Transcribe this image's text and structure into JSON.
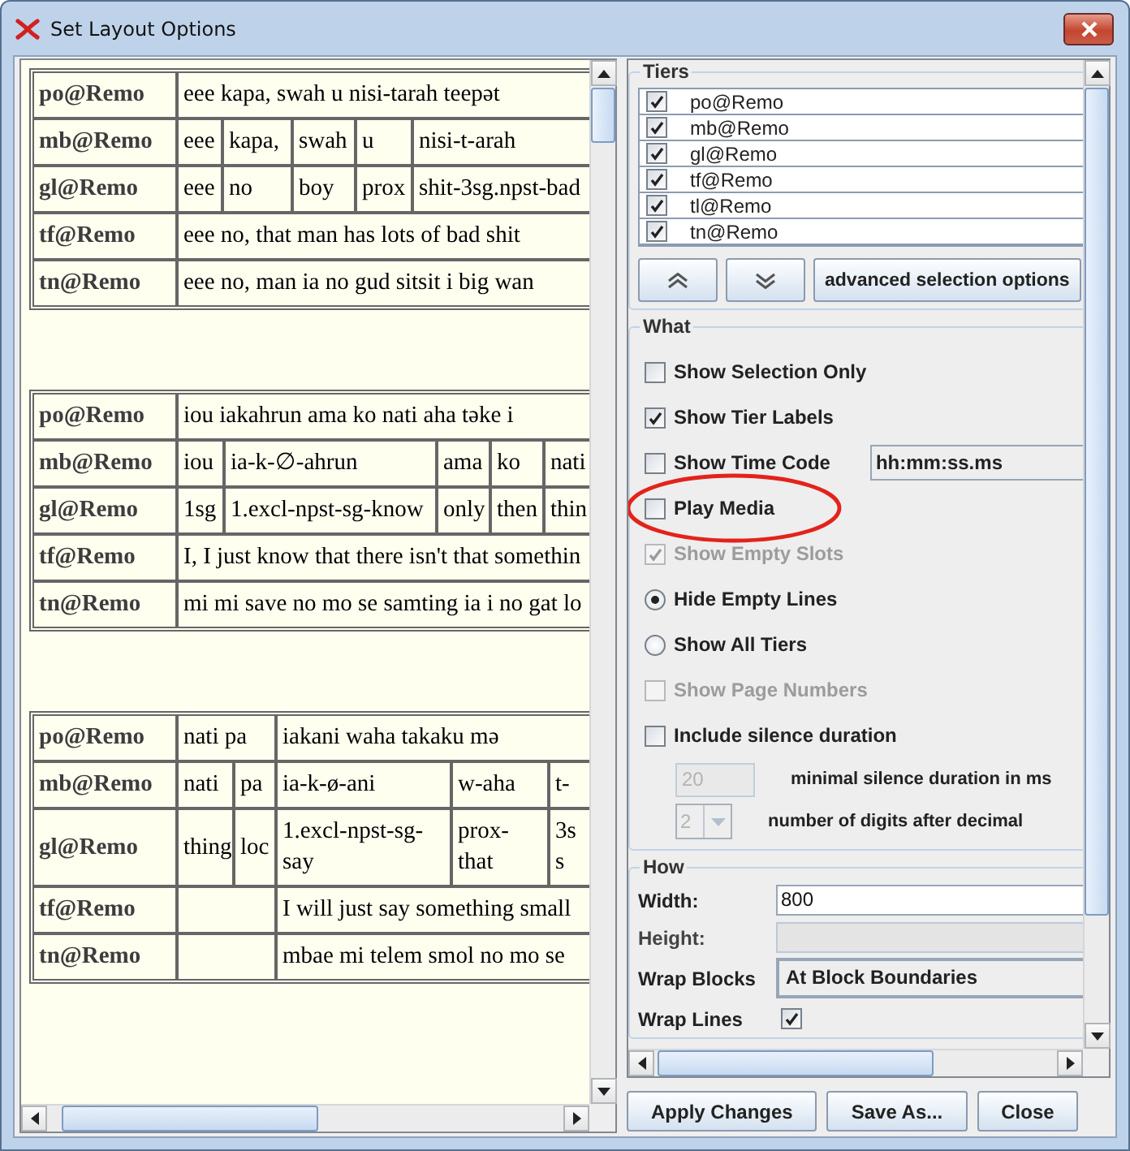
{
  "window": {
    "title": "Set Layout Options"
  },
  "blocks": [
    {
      "tiers": [
        {
          "label": "po@Remo",
          "kind": "po"
        },
        {
          "label": "mb@Remo",
          "kind": "mb"
        },
        {
          "label": "gl@Remo",
          "kind": "gl"
        },
        {
          "label": "tf@Remo",
          "kind": "tf"
        },
        {
          "label": "tn@Remo",
          "kind": "tn"
        }
      ],
      "segments": [
        {
          "po": "eee kapa, swah u nisi-tarah teepət",
          "tf": "eee no, that man has lots of bad shit",
          "tn": "eee no, man ia no gud sitsit i big wan",
          "morphemes": [
            {
              "mb": "eee",
              "gl": "eee"
            },
            {
              "mb": "kapa,",
              "gl": "no"
            },
            {
              "mb": "swah",
              "gl": "boy"
            },
            {
              "mb": "u",
              "gl": "prox"
            },
            {
              "mb": "nisi-t-arah",
              "gl": "shit-3sg.npst-bad"
            }
          ]
        }
      ]
    },
    {
      "tiers": [
        {
          "label": "po@Remo",
          "kind": "po"
        },
        {
          "label": "mb@Remo",
          "kind": "mb"
        },
        {
          "label": "gl@Remo",
          "kind": "gl"
        },
        {
          "label": "tf@Remo",
          "kind": "tf"
        },
        {
          "label": "tn@Remo",
          "kind": "tn"
        }
      ],
      "segments": [
        {
          "po": "iou iakahrun ama ko nati aha təke i",
          "tf": "I, I just know that there isn't that somethin",
          "tn": "mi mi save no mo se samting ia i no gat lo",
          "morphemes": [
            {
              "mb": "iou",
              "gl": "1sg"
            },
            {
              "mb": "ia-k-∅-ahrun",
              "gl": "1.excl-npst-sg-know"
            },
            {
              "mb": "ama",
              "gl": "only"
            },
            {
              "mb": "ko",
              "gl": "then"
            },
            {
              "mb": "nati",
              "gl": "thin"
            }
          ]
        }
      ]
    },
    {
      "tiers": [
        {
          "label": "po@Remo",
          "kind": "po"
        },
        {
          "label": "mb@Remo",
          "kind": "mb"
        },
        {
          "label": "gl@Remo",
          "kind": "gl"
        },
        {
          "label": "tf@Remo",
          "kind": "tf"
        },
        {
          "label": "tn@Remo",
          "kind": "tn"
        }
      ],
      "segments": [
        {
          "po": "nati pa",
          "morphemes": [
            {
              "mb": "nati",
              "gl": "thing"
            },
            {
              "mb": "pa",
              "gl": "loc"
            }
          ]
        },
        {
          "po": "iakani waha takaku mə",
          "tf": "I will just say something small",
          "tn": "mbae mi telem smol no mo se",
          "morphemes": [
            {
              "mb": "ia-k-ø-ani",
              "gl": "1.excl-npst-sg-say"
            },
            {
              "mb": "w-aha",
              "gl": "prox-that"
            },
            {
              "mb": "t-",
              "gl": "3s s"
            }
          ]
        }
      ]
    }
  ],
  "tiers_panel": {
    "title": "Tiers",
    "items": [
      {
        "label": "po@Remo",
        "checked": true
      },
      {
        "label": "mb@Remo",
        "checked": true
      },
      {
        "label": "gl@Remo",
        "checked": true
      },
      {
        "label": "tf@Remo",
        "checked": true
      },
      {
        "label": "tl@Remo",
        "checked": true
      },
      {
        "label": "tn@Remo",
        "checked": true
      }
    ],
    "advanced_button": "advanced selection options"
  },
  "what": {
    "title": "What",
    "items": [
      {
        "kind": "checkbox",
        "label": "Show Selection Only",
        "checked": false,
        "disabled": false,
        "highlighted": false
      },
      {
        "kind": "checkbox",
        "label": "Show Tier Labels",
        "checked": true,
        "disabled": false,
        "highlighted": false
      },
      {
        "kind": "checkbox",
        "label": "Show Time Code",
        "checked": false,
        "disabled": false,
        "highlighted": false,
        "field": "hh:mm:ss.ms"
      },
      {
        "kind": "checkbox",
        "label": "Play Media",
        "checked": false,
        "disabled": false,
        "highlighted": true
      },
      {
        "kind": "checkbox",
        "label": "Show Empty Slots",
        "checked": true,
        "disabled": true,
        "highlighted": false
      },
      {
        "kind": "radio",
        "label": "Hide Empty Lines",
        "selected": true,
        "disabled": false,
        "highlighted": false
      },
      {
        "kind": "radio",
        "label": "Show All Tiers",
        "selected": false,
        "disabled": false,
        "highlighted": false
      },
      {
        "kind": "checkbox",
        "label": "Show Page Numbers",
        "checked": false,
        "disabled": true,
        "highlighted": false
      },
      {
        "kind": "checkbox",
        "label": "Include silence duration",
        "checked": false,
        "disabled": false,
        "highlighted": false,
        "children": [
          {
            "kind": "number",
            "label": "minimal silence duration in ms",
            "value": "20",
            "disabled": true
          },
          {
            "kind": "digits",
            "label": "number of digits after decimal",
            "value": "2",
            "disabled": true
          }
        ]
      }
    ]
  },
  "how": {
    "title": "How",
    "items": [
      {
        "kind": "field",
        "label": "Width:",
        "value": "800",
        "disabled": false
      },
      {
        "kind": "field",
        "label": "Height:",
        "disabled": true
      },
      {
        "kind": "select",
        "label": "Wrap Blocks",
        "value": "At Block Boundaries",
        "disabled": false
      },
      {
        "kind": "checkbox",
        "label": "Wrap Lines",
        "checked": true,
        "disabled": false
      }
    ]
  },
  "buttons": [
    "Apply Changes",
    "Save As...",
    "Close"
  ]
}
